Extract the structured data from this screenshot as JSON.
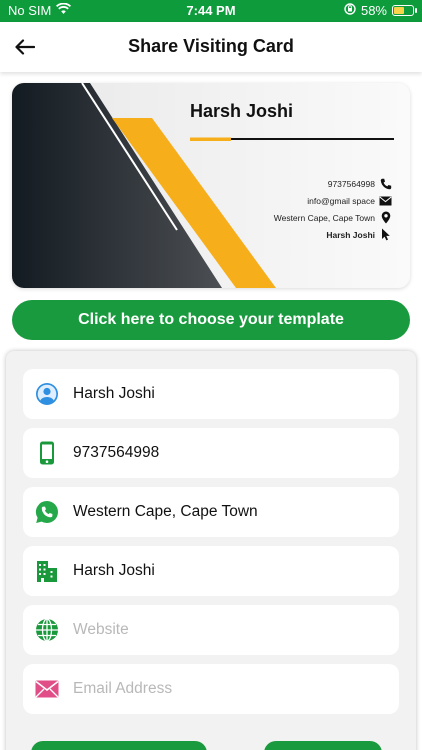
{
  "status_bar": {
    "carrier": "No SIM",
    "time": "7:44 PM",
    "battery_percent": "58%",
    "battery_level": 0.58
  },
  "header": {
    "title": "Share Visiting Card",
    "back_icon": "arrow-left-icon"
  },
  "card": {
    "name": "Harsh Joshi",
    "phone": "9737564998",
    "email": "info@gmail space",
    "address": "Western Cape, Cape Town",
    "company": "Harsh Joshi",
    "colors": {
      "dark": "#1c232b",
      "accent": "#f6ae1b"
    }
  },
  "template_button": {
    "label": "Click here to choose your template"
  },
  "form": {
    "fields": [
      {
        "icon": "user-icon",
        "value": "Harsh Joshi",
        "placeholder": ""
      },
      {
        "icon": "mobile-phone-icon",
        "value": "9737564998",
        "placeholder": ""
      },
      {
        "icon": "whatsapp-icon",
        "value": "Western Cape, Cape Town",
        "placeholder": ""
      },
      {
        "icon": "building-icon",
        "value": "Harsh Joshi",
        "placeholder": ""
      },
      {
        "icon": "globe-icon",
        "value": "",
        "placeholder": "Website"
      },
      {
        "icon": "email-icon",
        "value": "",
        "placeholder": "Email Address"
      }
    ]
  },
  "theme": {
    "green": "#1a9a3e",
    "status_green": "#0e9b3c"
  }
}
